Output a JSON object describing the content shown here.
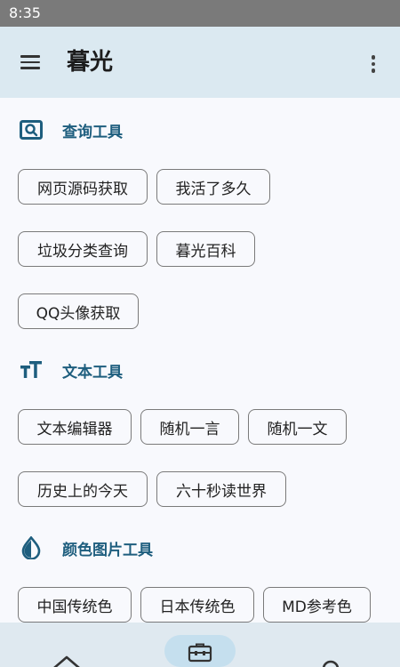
{
  "status_bar": {
    "time": "8:35"
  },
  "app_bar": {
    "title": "暮光"
  },
  "sections": [
    {
      "title": "查询工具",
      "icon": "search-image-icon",
      "chips": [
        "网页源码获取",
        "我活了多久",
        "垃圾分类查询",
        "暮光百科",
        "QQ头像获取"
      ]
    },
    {
      "title": "文本工具",
      "icon": "text-size-icon",
      "chips": [
        "文本编辑器",
        "随机一言",
        "随机一文",
        "历史上的今天",
        "六十秒读世界"
      ]
    },
    {
      "title": "颜色图片工具",
      "icon": "color-drop-icon",
      "chips": [
        "中国传统色",
        "日本传统色",
        "MD参考色"
      ]
    }
  ],
  "bottom_nav": {
    "items": [
      {
        "icon": "home-icon",
        "selected": false
      },
      {
        "icon": "toolbox-icon",
        "selected": true
      },
      {
        "icon": "person-icon",
        "selected": false
      }
    ]
  },
  "colors": {
    "accent": "#1e5e7e",
    "app_bar": "#dbe9f1",
    "background": "#f8f9fd",
    "nav_selected": "#c5dfee"
  }
}
